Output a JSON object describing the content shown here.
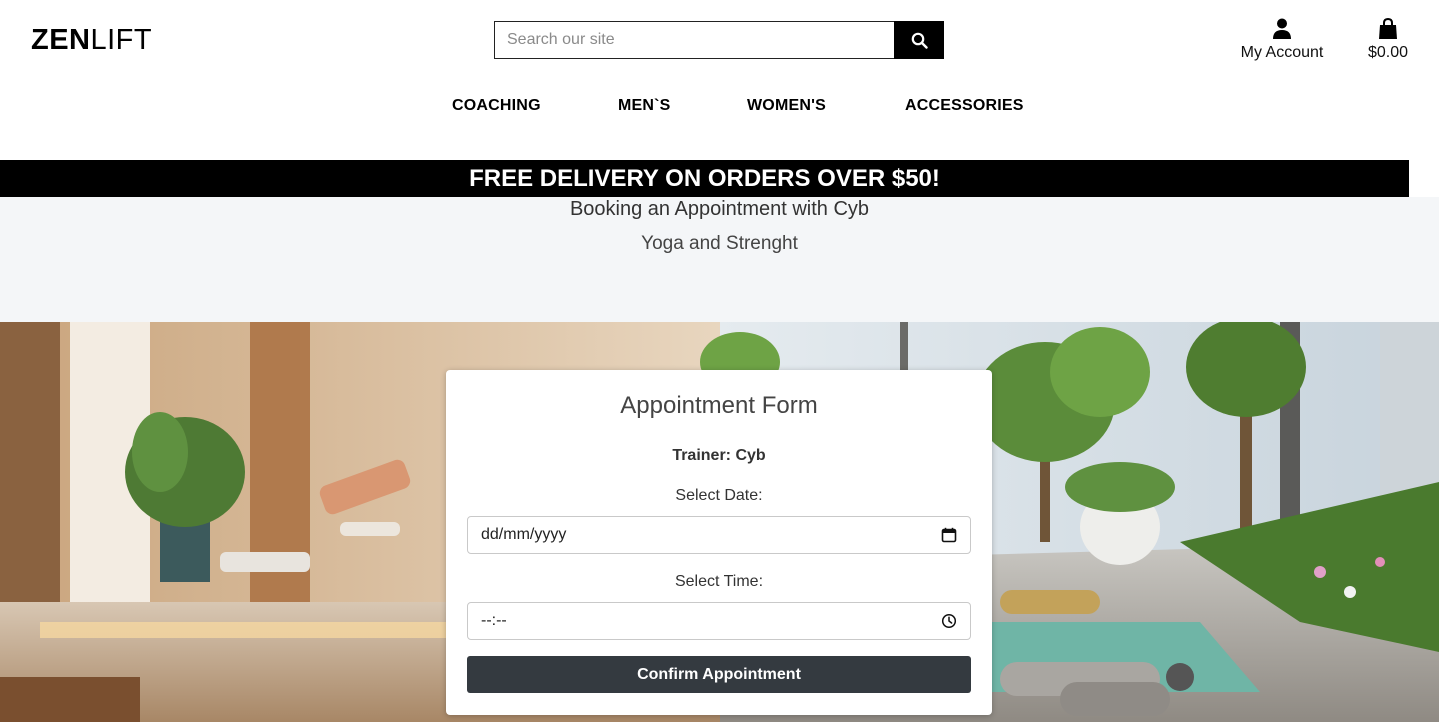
{
  "header": {
    "logo_bold": "ZEN",
    "logo_light": "LIFT",
    "search_placeholder": "Search our site",
    "account_label": "My Account",
    "bag_total": "$0.00"
  },
  "nav": {
    "items": [
      {
        "label": "COACHING"
      },
      {
        "label": "MEN`S"
      },
      {
        "label": "WOMEN'S"
      },
      {
        "label": "ACCESSORIES"
      }
    ]
  },
  "banner": {
    "text": "FREE DELIVERY ON ORDERS OVER $50!"
  },
  "page": {
    "title": "Booking an Appointment with Cyb",
    "subtitle": "Yoga and Strenght"
  },
  "form": {
    "title": "Appointment Form",
    "trainer": "Trainer: Cyb",
    "date_label": "Select Date:",
    "date_value": "dd/mm/yyyy",
    "time_label": "Select Time:",
    "time_value": "--:--",
    "confirm_label": "Confirm Appointment"
  },
  "colors": {
    "banner_bg": "#000000",
    "title_area_bg": "#f4f6f8",
    "button_bg": "#343a40"
  },
  "icons": [
    "search-icon",
    "user-icon",
    "shopping-bag-icon",
    "calendar-icon",
    "clock-icon"
  ]
}
